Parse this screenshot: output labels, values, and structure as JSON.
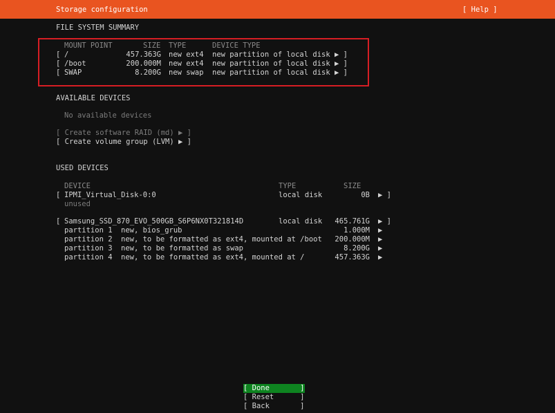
{
  "header": {
    "title": "Storage configuration",
    "help_label": "[ Help ]"
  },
  "fs_summary": {
    "title": "FILE SYSTEM SUMMARY",
    "columns": [
      "MOUNT POINT",
      "SIZE",
      "TYPE",
      "DEVICE TYPE"
    ],
    "rows": [
      {
        "open": "[",
        "mount": "/",
        "size": "457.363G",
        "type": "new ext4",
        "device_type": "new partition of local disk",
        "arrow": "▶ ]"
      },
      {
        "open": "[",
        "mount": "/boot",
        "size": "200.000M",
        "type": "new ext4",
        "device_type": "new partition of local disk",
        "arrow": "▶ ]"
      },
      {
        "open": "[",
        "mount": "SWAP",
        "size": "8.200G",
        "type": "new swap",
        "device_type": "new partition of local disk",
        "arrow": "▶ ]"
      }
    ]
  },
  "available": {
    "title": "AVAILABLE DEVICES",
    "empty_text": "No available devices",
    "create_raid": "[ Create software RAID (md) ▶ ]",
    "create_lvm": "[ Create volume group (LVM) ▶ ]"
  },
  "used": {
    "title": "USED DEVICES",
    "columns": [
      "DEVICE",
      "TYPE",
      "SIZE"
    ],
    "disk1": {
      "open": "[",
      "name": "IPMI_Virtual_Disk-0:0",
      "type": "local disk",
      "size": "0B",
      "arrow": "▶ ]",
      "status": "unused"
    },
    "disk2": {
      "open": "[",
      "name": "Samsung_SSD_870_EVO_500GB_S6P6NX0T321814D",
      "type": "local disk",
      "size": "465.761G",
      "arrow": "▶ ]"
    },
    "partitions": [
      {
        "name": "partition 1",
        "desc": "new, bios_grub",
        "size": "1.000M",
        "arrow": "▶"
      },
      {
        "name": "partition 2",
        "desc": "new, to be formatted as ext4, mounted at /boot",
        "size": "200.000M",
        "arrow": "▶"
      },
      {
        "name": "partition 3",
        "desc": "new, to be formatted as swap",
        "size": "8.200G",
        "arrow": "▶"
      },
      {
        "name": "partition 4",
        "desc": "new, to be formatted as ext4, mounted at /",
        "size": "457.363G",
        "arrow": "▶"
      }
    ]
  },
  "buttons": {
    "done": "[ Done       ]",
    "reset": "[ Reset      ]",
    "back": "[ Back       ]"
  },
  "colors": {
    "header_bg": "#e95420",
    "highlight_box": "#d81e24",
    "active_button": "#0e8420"
  }
}
